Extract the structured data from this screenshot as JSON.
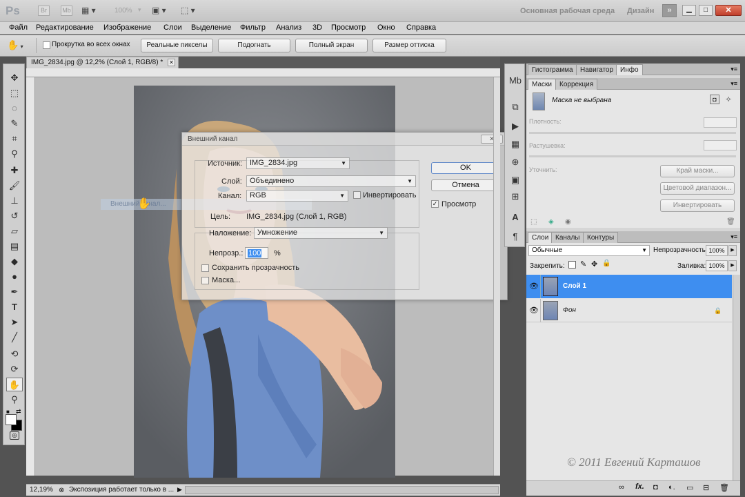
{
  "app": {
    "logo": "Ps",
    "zoom_display": "100%",
    "workspace": "Основная рабочая среда",
    "design": "Дизайн"
  },
  "menu": [
    "Файл",
    "Редактирование",
    "Изображение",
    "Слои",
    "Выделение",
    "Фильтр",
    "Анализ",
    "3D",
    "Просмотр",
    "Окно",
    "Справка"
  ],
  "options": {
    "scroll_all": "Прокрутка во всех окнах",
    "buttons": [
      "Реальные пикселы",
      "Подогнать",
      "Полный экран",
      "Размер оттиска"
    ]
  },
  "document": {
    "tab": "IMG_2834.jpg @ 12,2% (Слой 1, RGB/8) *",
    "zoom": "12,19%",
    "status": "Экспозиция работает только в ...",
    "drag_label": "Внешний канал..."
  },
  "dialog": {
    "title": "Внешний канал",
    "source_label": "Источник:",
    "source_value": "IMG_2834.jpg",
    "layer_label": "Слой:",
    "layer_value": "Объединено",
    "channel_label": "Канал:",
    "channel_value": "RGB",
    "invert_label": "Инвертировать",
    "target_label": "Цель:",
    "target_value": "IMG_2834.jpg (Слой 1, RGB)",
    "blend_label": "Наложение:",
    "blend_value": "Умножение",
    "opacity_label": "Непрозр.:",
    "opacity_value": "100",
    "opacity_unit": "%",
    "preserve_label": "Сохранить прозрачность",
    "mask_label": "Маска...",
    "ok": "OK",
    "cancel": "Отмена",
    "preview_label": "Просмотр",
    "preview_checked": true
  },
  "panels": {
    "top_tabs": [
      "Гистограмма",
      "Навигатор",
      "Инфо"
    ],
    "masks_tabs": [
      "Маски",
      "Коррекция"
    ],
    "mask_status": "Маска не выбрана",
    "density_label": "Плотность:",
    "feather_label": "Растушевка:",
    "refine_label": "Уточнить:",
    "mask_buttons": [
      "Край маски...",
      "Цветовой диапазон...",
      "Инвертировать"
    ],
    "layers_tabs": [
      "Слои",
      "Каналы",
      "Контуры"
    ],
    "blend_mode": "Обычные",
    "opacity_label": "Непрозрачность:",
    "opacity_value": "100%",
    "lock_label": "Закрепить:",
    "fill_label": "Заливка:",
    "fill_value": "100%",
    "layers": [
      {
        "name": "Слой 1",
        "selected": true,
        "locked": false
      },
      {
        "name": "Фон",
        "selected": false,
        "locked": true
      }
    ]
  },
  "watermark": "© 2011 Евгений Карташов",
  "colors": {
    "selection": "#3e8ef0",
    "panel_bg": "#d6d6d6",
    "canvas_bg": "#bcbcbc"
  }
}
